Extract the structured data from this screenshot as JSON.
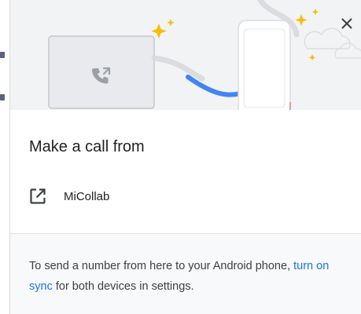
{
  "dialog": {
    "close_icon": "close-icon",
    "title": "Make a call from",
    "apps": [
      {
        "label": "MiCollab",
        "icon": "open-in-new-icon"
      }
    ],
    "footer": {
      "text_before_link": "To send a number from here to your Android phone, ",
      "link_text": "turn on sync",
      "text_after_link": " for both devices in settings."
    },
    "illustration": {
      "computer_icon": "phone-forwarded-icon",
      "accent_color": "#4285f4",
      "sparkle_color": "#fbbc04"
    }
  }
}
